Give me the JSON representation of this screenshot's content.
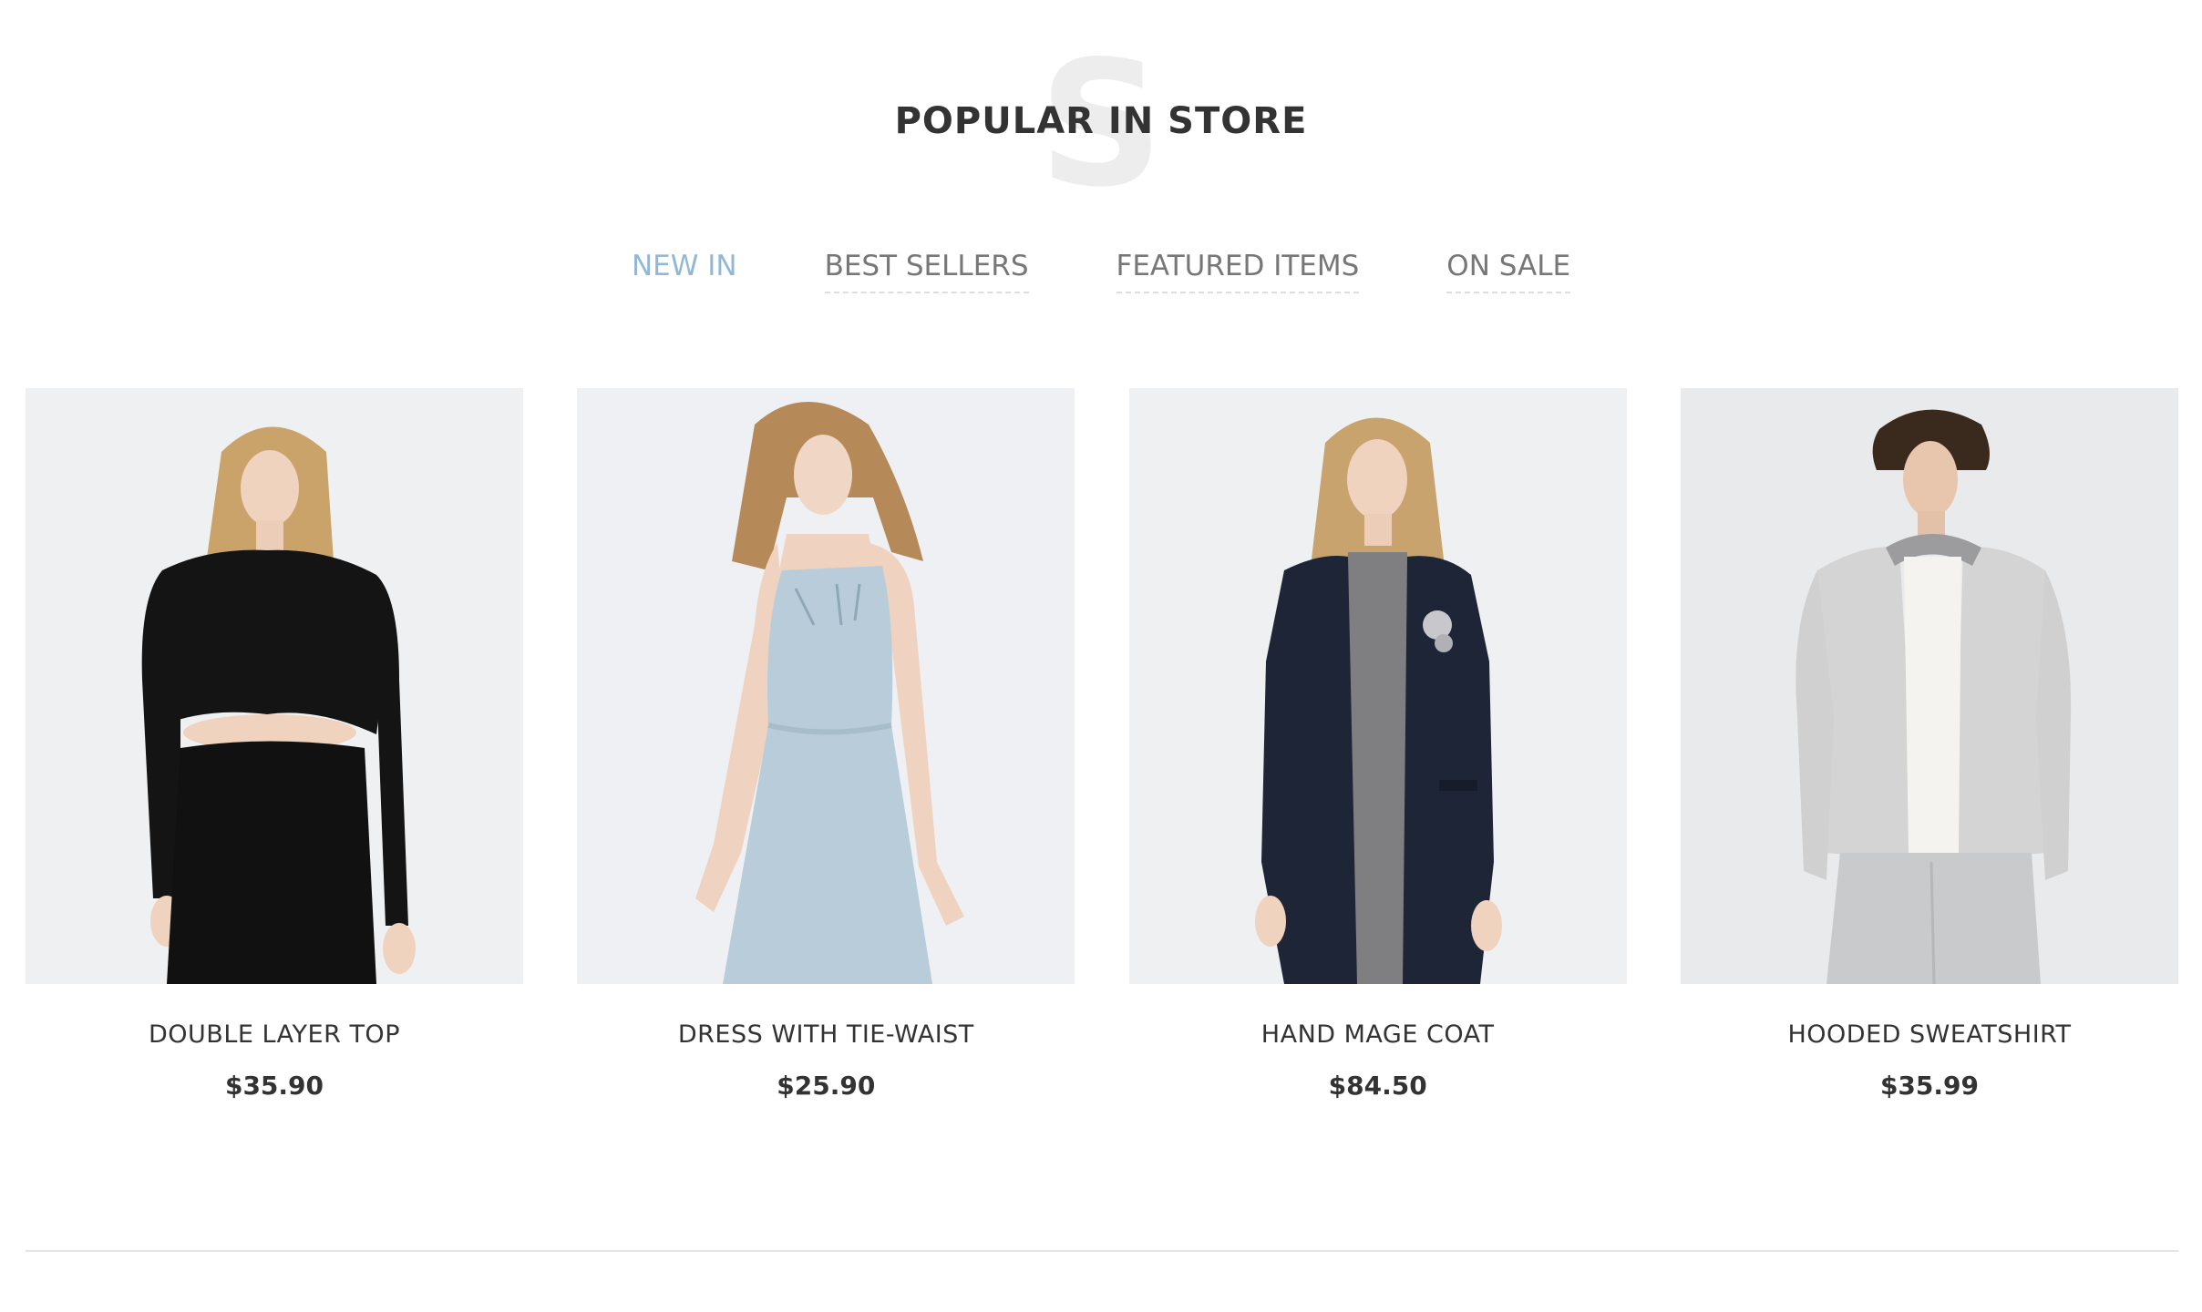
{
  "section": {
    "watermark_letter": "S",
    "title": "POPULAR IN STORE"
  },
  "tabs": [
    {
      "label": "NEW IN",
      "active": true
    },
    {
      "label": "BEST SELLERS",
      "active": false
    },
    {
      "label": "FEATURED ITEMS",
      "active": false
    },
    {
      "label": "ON SALE",
      "active": false
    }
  ],
  "products": [
    {
      "name": "DOUBLE LAYER TOP",
      "price": "$35.90"
    },
    {
      "name": "DRESS WITH TIE-WAIST",
      "price": "$25.90"
    },
    {
      "name": "HAND MAGE COAT",
      "price": "$84.50"
    },
    {
      "name": "HOODED SWEATSHIRT",
      "price": "$35.99"
    }
  ],
  "colors": {
    "active_tab": "#92b8d6",
    "text": "#333333",
    "muted_tab": "#777777",
    "photo_bg": "#f0f1f3"
  }
}
